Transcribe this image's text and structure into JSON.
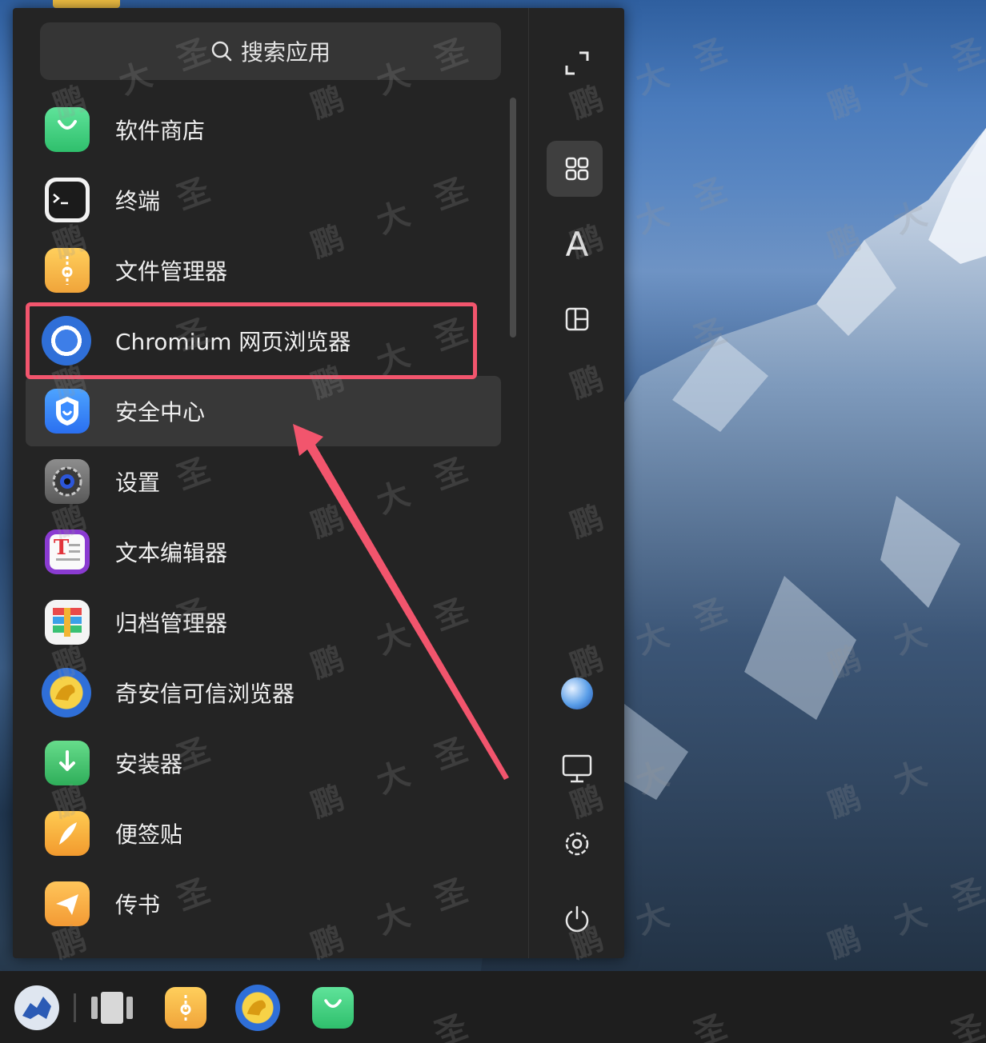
{
  "search": {
    "label": "搜索应用",
    "icon": "search-icon"
  },
  "apps": [
    {
      "label": "软件商店",
      "icon": "app-store-icon"
    },
    {
      "label": "终端",
      "icon": "terminal-icon"
    },
    {
      "label": "文件管理器",
      "icon": "file-manager-icon"
    },
    {
      "label": "Chromium 网页浏览器",
      "icon": "chromium-icon"
    },
    {
      "label": "安全中心",
      "icon": "security-center-icon"
    },
    {
      "label": "设置",
      "icon": "settings-icon"
    },
    {
      "label": "文本编辑器",
      "icon": "text-editor-icon"
    },
    {
      "label": "归档管理器",
      "icon": "archive-manager-icon"
    },
    {
      "label": "奇安信可信浏览器",
      "icon": "qianxin-browser-icon"
    },
    {
      "label": "安装器",
      "icon": "installer-icon"
    },
    {
      "label": "便签贴",
      "icon": "sticky-notes-icon"
    },
    {
      "label": "传书",
      "icon": "file-transfer-icon"
    }
  ],
  "sidebar": {
    "expand": "expand-icon",
    "view_all": "grid-icon",
    "letter_sort": "A",
    "category": "category-icon",
    "user": "user-avatar-icon",
    "computer": "computer-icon",
    "settings": "gear-icon",
    "power": "power-icon"
  },
  "taskbar": {
    "items": [
      "start-menu-icon",
      "multitask-view-icon",
      "file-manager-icon",
      "qianxin-browser-icon",
      "app-store-icon"
    ]
  },
  "watermark": {
    "text": [
      "鹏",
      "大",
      "圣"
    ]
  },
  "annotation": {
    "highlight_color": "#f2556d",
    "highlighted_app": "Chromium 网页浏览器"
  }
}
